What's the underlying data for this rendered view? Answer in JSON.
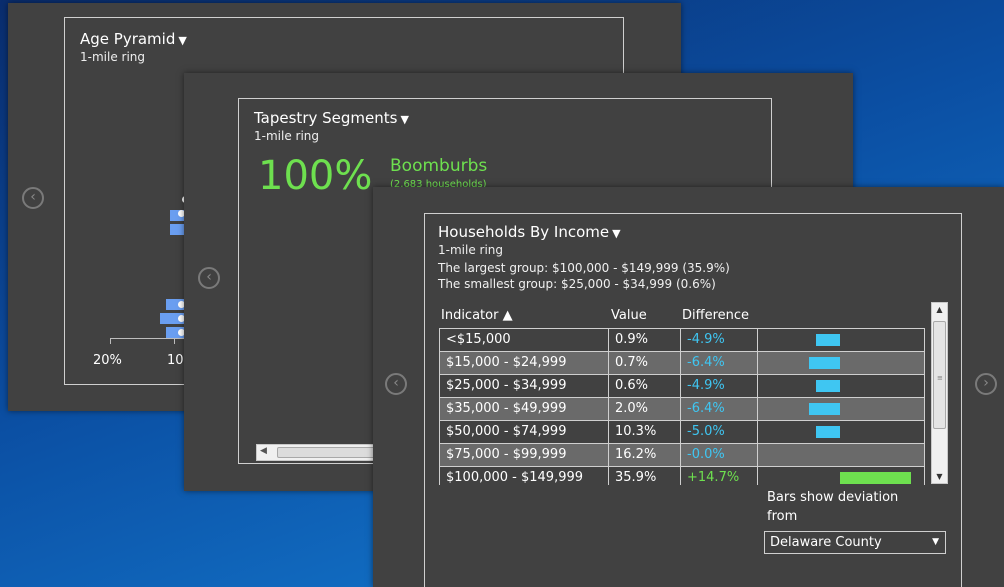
{
  "age_pyramid": {
    "title": "Age Pyramid",
    "caret": "▼",
    "subtitle": "1-mile ring",
    "axis_ticks": [
      "20%",
      "10"
    ]
  },
  "tapestry": {
    "title": "Tapestry Segments",
    "caret": "▼",
    "subtitle": "1-mile ring",
    "percent": "100%",
    "segment_name": "Boomburbs",
    "segment_households": "(2,683 households)"
  },
  "income": {
    "title": "Households By Income",
    "caret": "▼",
    "subtitle": "1-mile ring",
    "largest_group": "The largest group: $100,000 - $149,999 (35.9%)",
    "smallest_group": "The smallest group: $25,000 - $34,999 (0.6%)",
    "columns": {
      "indicator": "Indicator ▲",
      "value": "Value",
      "difference": "Difference"
    },
    "rows": [
      {
        "indicator": "<$15,000",
        "value": "0.9%",
        "difference": "-4.9%",
        "deviation": -4.9
      },
      {
        "indicator": "$15,000 - $24,999",
        "value": "0.7%",
        "difference": "-6.4%",
        "deviation": -6.4
      },
      {
        "indicator": "$25,000 - $34,999",
        "value": "0.6%",
        "difference": "-4.9%",
        "deviation": -4.9
      },
      {
        "indicator": "$35,000 - $49,999",
        "value": "2.0%",
        "difference": "-6.4%",
        "deviation": -6.4
      },
      {
        "indicator": "$50,000 - $74,999",
        "value": "10.3%",
        "difference": "-5.0%",
        "deviation": -5.0
      },
      {
        "indicator": "$75,000 - $99,999",
        "value": "16.2%",
        "difference": "-0.0%",
        "deviation": 0.0
      },
      {
        "indicator": "$100,000 - $149,999",
        "value": "35.9%",
        "difference": "+14.7%",
        "deviation": 14.7
      }
    ],
    "deviation_note": "Bars show deviation from",
    "compare_area": "Delaware County",
    "colors": {
      "negative": "#3fc6f2",
      "positive": "#6ee04f"
    }
  },
  "icons": {
    "left_arrow": "‹",
    "right_arrow": "›",
    "select_caret": "▼"
  }
}
